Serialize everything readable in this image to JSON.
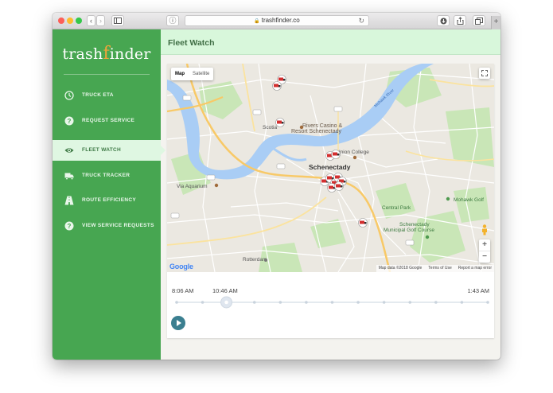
{
  "browser": {
    "url": "trashfinder.co",
    "buttons": {
      "back": "‹",
      "forward": "›",
      "info": "ⓘ",
      "reload": "↻",
      "new_tab": "+"
    }
  },
  "sidebar": {
    "logo": {
      "left": "trash",
      "f": "f",
      "right": "inder"
    },
    "items": [
      {
        "label": "TRUCK ETA",
        "icon": "clock-icon",
        "active": false
      },
      {
        "label": "REQUEST SERVICE",
        "icon": "question-icon",
        "active": false
      },
      {
        "label": "FLEET WATCH",
        "icon": "eye-icon",
        "active": true
      },
      {
        "label": "TRUCK TRACKER",
        "icon": "truck-icon",
        "active": false
      },
      {
        "label": "ROUTE EFFICIENCY",
        "icon": "road-icon",
        "active": false
      },
      {
        "label": "VIEW SERVICE REQUESTS",
        "icon": "question-icon",
        "active": false
      }
    ]
  },
  "header": {
    "title": "Fleet Watch"
  },
  "map": {
    "type_options": [
      "Map",
      "Satellite"
    ],
    "selected_type": "Map",
    "labels": {
      "rivers_casino_1": "Rivers Casino &",
      "rivers_casino_2": "Resort Schenectady",
      "scotia": "Scotia",
      "union_college": "Union College",
      "schenectady": "Schenectady",
      "via_aquarium": "Via Aquarium",
      "central_park": "Central Park",
      "golf_1": "Schenectady",
      "golf_2": "Municipal Golf Course",
      "rotterdam": "Rotterdam",
      "mohawk_golf": "Mohawk Golf",
      "mohawk_river": "Mohawk River"
    },
    "google": "Google",
    "attribution": "Map data ©2018 Google",
    "terms": "Terms of Use",
    "report": "Report a map error",
    "truck_count": 13
  },
  "timeline": {
    "start_label": "8:06 AM",
    "current_label": "10:46 AM",
    "end_label": "1:43 AM",
    "position": 0.16,
    "tick_count": 13
  },
  "colors": {
    "sidebar": "#47a651",
    "header": "#d8f7db",
    "accent_orange": "#f0a43a",
    "play_button": "#3b7f90",
    "river": "#a9cdf5",
    "park": "#c9e6b7",
    "highway": "#f8c967",
    "truck": "#d32f2f"
  }
}
